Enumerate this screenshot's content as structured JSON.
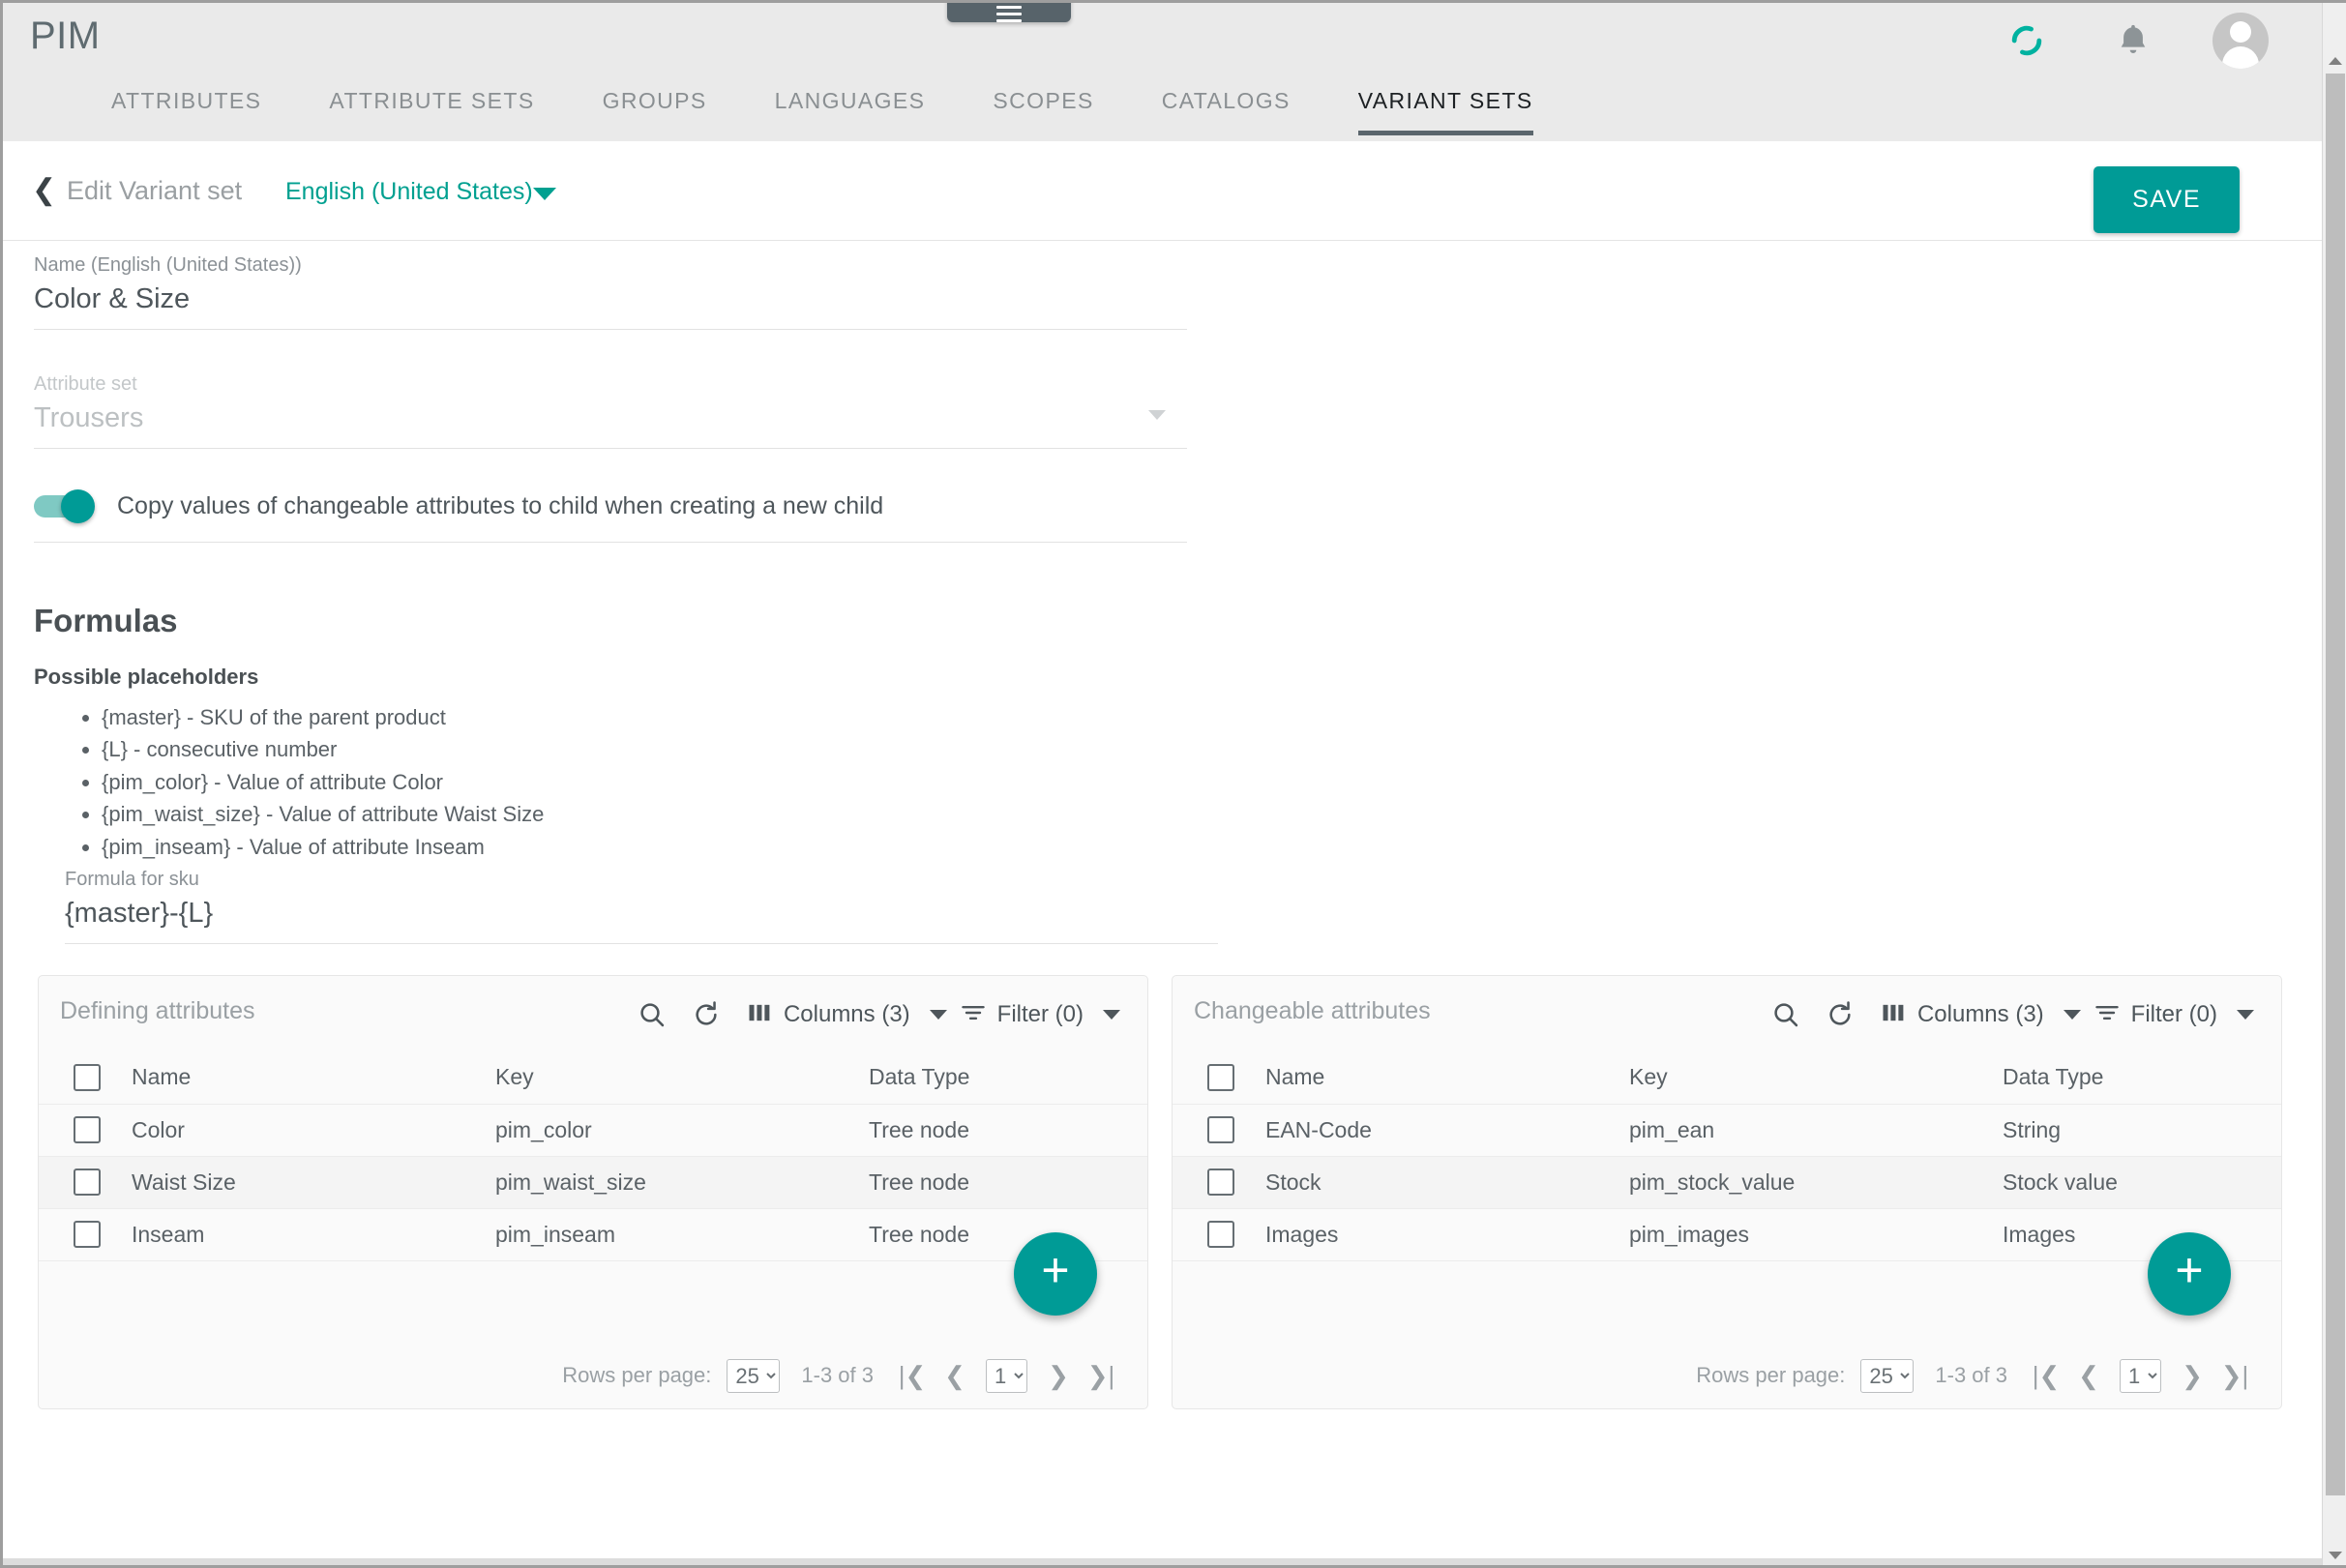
{
  "header": {
    "brand": "PIM",
    "drag_handle_icon": "hamburger-icon",
    "sync_icon": "sync-icon",
    "notifications_icon": "bell-icon",
    "avatar_icon": "user-avatar-icon"
  },
  "tabs": [
    {
      "label": "ATTRIBUTES",
      "active": false
    },
    {
      "label": "ATTRIBUTE SETS",
      "active": false
    },
    {
      "label": "GROUPS",
      "active": false
    },
    {
      "label": "LANGUAGES",
      "active": false
    },
    {
      "label": "SCOPES",
      "active": false
    },
    {
      "label": "CATALOGS",
      "active": false
    },
    {
      "label": "VARIANT SETS",
      "active": true
    }
  ],
  "subheader": {
    "back_icon": "chevron-left-icon",
    "title": "Edit Variant set",
    "language": "English (United States)",
    "language_caret_icon": "chevron-down-icon",
    "save_label": "SAVE"
  },
  "form": {
    "name_label": "Name (English (United States))",
    "name_value": "Color & Size",
    "attribute_set_label": "Attribute set",
    "attribute_set_value": "Trousers",
    "copy_toggle_label": "Copy values of changeable attributes to child when creating a new child",
    "copy_toggle_on": true
  },
  "formulas": {
    "heading": "Formulas",
    "placeholders_title": "Possible placeholders",
    "placeholders": [
      "{master} - SKU of the parent product",
      "{L} - consecutive number",
      "{pim_color} - Value of attribute Color",
      "{pim_waist_size} - Value of attribute Waist Size",
      "{pim_inseam} - Value of attribute Inseam"
    ],
    "sku_label": "Formula for sku",
    "sku_value": "{master}-{L}"
  },
  "tables": {
    "defining": {
      "title": "Defining attributes",
      "search_icon": "search-icon",
      "refresh_icon": "refresh-icon",
      "columns_icon": "columns-icon",
      "columns_label": "Columns (3)",
      "filter_icon": "filter-icon",
      "filter_label": "Filter (0)",
      "headers": [
        "Name",
        "Key",
        "Data Type"
      ],
      "rows": [
        {
          "name": "Color",
          "key": "pim_color",
          "type": "Tree node"
        },
        {
          "name": "Waist Size",
          "key": "pim_waist_size",
          "type": "Tree node"
        },
        {
          "name": "Inseam",
          "key": "pim_inseam",
          "type": "Tree node"
        }
      ],
      "add_label": "+",
      "paginator": {
        "rows_label": "Rows per page:",
        "rows_value": "25",
        "range": "1-3 of 3",
        "page_value": "1",
        "first_icon": "first-page-icon",
        "prev_icon": "previous-page-icon",
        "next_icon": "next-page-icon",
        "last_icon": "last-page-icon"
      }
    },
    "changeable": {
      "title": "Changeable attributes",
      "search_icon": "search-icon",
      "refresh_icon": "refresh-icon",
      "columns_icon": "columns-icon",
      "columns_label": "Columns (3)",
      "filter_icon": "filter-icon",
      "filter_label": "Filter (0)",
      "headers": [
        "Name",
        "Key",
        "Data Type"
      ],
      "rows": [
        {
          "name": "EAN-Code",
          "key": "pim_ean",
          "type": "String"
        },
        {
          "name": "Stock",
          "key": "pim_stock_value",
          "type": "Stock value"
        },
        {
          "name": "Images",
          "key": "pim_images",
          "type": "Images"
        }
      ],
      "add_label": "+",
      "paginator": {
        "rows_label": "Rows per page:",
        "rows_value": "25",
        "range": "1-3 of 3",
        "page_value": "1",
        "first_icon": "first-page-icon",
        "prev_icon": "previous-page-icon",
        "next_icon": "next-page-icon",
        "last_icon": "last-page-icon"
      }
    }
  },
  "colors": {
    "accent": "#009b96",
    "header_bg": "#eaeaea",
    "active_tab_underline": "#5b666d",
    "text_primary": "#4e565b",
    "text_muted": "#9aa0a4"
  },
  "scrollbar": {
    "up_icon": "scroll-up-icon",
    "down_icon": "scroll-down-icon"
  }
}
